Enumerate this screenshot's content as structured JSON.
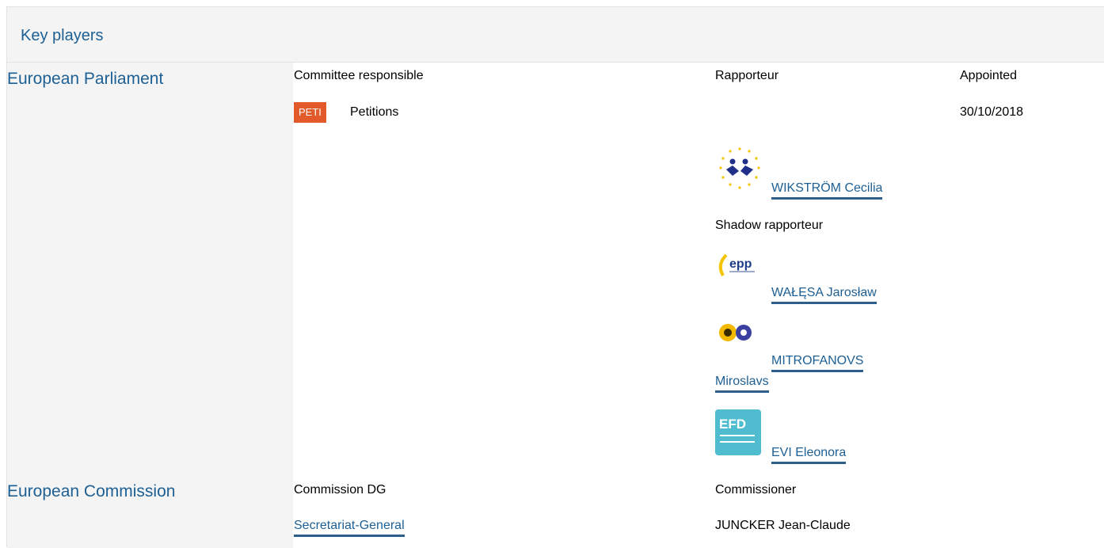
{
  "section": {
    "title": "Key players"
  },
  "parliament": {
    "label": "European Parliament",
    "col_committee": "Committee responsible",
    "col_rapporteur": "Rapporteur",
    "col_appointed": "Appointed",
    "committee_code": "PETI",
    "committee_name": "Petitions",
    "appointed_date": "30/10/2018",
    "rapporteur": {
      "name": "WIKSTRÖM Cecilia",
      "group_logo": "alde-logo"
    },
    "shadow_label": "Shadow rapporteur",
    "shadows": [
      {
        "name": "WAŁĘSA Jarosław",
        "group_logo": "epp-logo"
      },
      {
        "name_line1": "MITROFANOVS",
        "name_line2": "Miroslavs",
        "group_logo": "greens-efa-logo"
      },
      {
        "name": "EVI Eleonora",
        "group_logo": "efdd-logo"
      }
    ]
  },
  "commission": {
    "label": "European Commission",
    "col_dg": "Commission DG",
    "col_commissioner": "Commissioner",
    "dg": "Secretariat-General",
    "commissioner": "JUNCKER Jean-Claude"
  },
  "colors": {
    "link": "#1e6094",
    "badge": "#e2592a",
    "panel": "#f4f4f4"
  }
}
